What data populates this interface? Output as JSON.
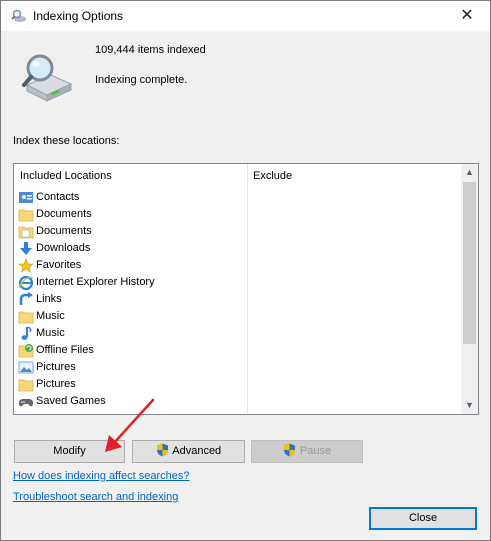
{
  "window": {
    "title": "Indexing Options",
    "close_glyph": "✕"
  },
  "status": {
    "items_indexed": "109,444 items indexed",
    "state": "Indexing complete."
  },
  "index_label": "Index these locations:",
  "columns": {
    "included": "Included Locations",
    "exclude": "Exclude"
  },
  "locations": [
    {
      "icon": "contacts-icon",
      "label": "Contacts"
    },
    {
      "icon": "folder-icon",
      "label": "Documents"
    },
    {
      "icon": "documents-icon",
      "label": "Documents"
    },
    {
      "icon": "downloads-icon",
      "label": "Downloads"
    },
    {
      "icon": "favorites-icon",
      "label": "Favorites"
    },
    {
      "icon": "internet-explorer-icon",
      "label": "Internet Explorer History"
    },
    {
      "icon": "links-icon",
      "label": "Links"
    },
    {
      "icon": "folder-icon",
      "label": "Music"
    },
    {
      "icon": "music-icon",
      "label": "Music"
    },
    {
      "icon": "offline-files-icon",
      "label": "Offline Files"
    },
    {
      "icon": "pictures-icon",
      "label": "Pictures"
    },
    {
      "icon": "folder-icon",
      "label": "Pictures"
    },
    {
      "icon": "saved-games-icon",
      "label": "Saved Games"
    }
  ],
  "buttons": {
    "modify": "Modify",
    "advanced": "Advanced",
    "pause": "Pause",
    "close": "Close"
  },
  "links": {
    "how": "How does indexing affect searches?",
    "troubleshoot": "Troubleshoot search and indexing"
  },
  "colors": {
    "link": "#0066cc",
    "annotation_arrow": "#e0202a",
    "focus_border": "#0078d7"
  }
}
